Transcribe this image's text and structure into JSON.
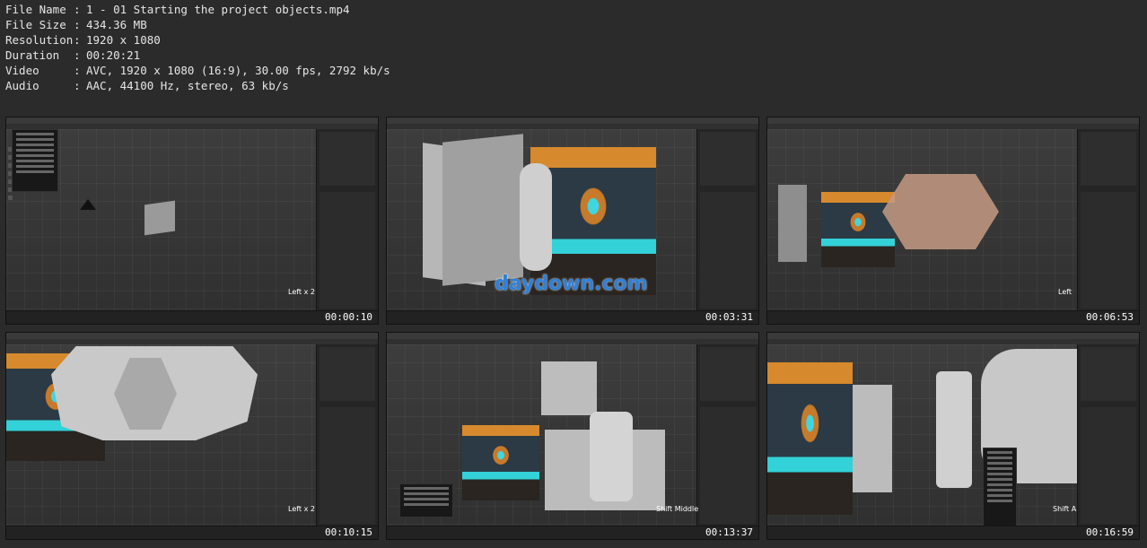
{
  "meta": {
    "rows": [
      {
        "key": "File Name",
        "value": "1 - 01 Starting the project objects.mp4"
      },
      {
        "key": "File Size",
        "value": "434.36 MB"
      },
      {
        "key": "Resolution",
        "value": "1920 x 1080"
      },
      {
        "key": "Duration",
        "value": "00:20:21"
      },
      {
        "key": "Video",
        "value": "AVC, 1920 x 1080 (16:9), 30.00 fps, 2792 kb/s"
      },
      {
        "key": "Audio",
        "value": "AAC, 44100 Hz, stereo, 63 kb/s"
      }
    ]
  },
  "thumbnails": [
    {
      "timestamp": "00:00:10",
      "hint": "Left x 2"
    },
    {
      "timestamp": "00:03:31",
      "hint": "",
      "watermark": "daydown.com"
    },
    {
      "timestamp": "00:06:53",
      "hint": "Left"
    },
    {
      "timestamp": "00:10:15",
      "hint": "Left x 2"
    },
    {
      "timestamp": "00:13:37",
      "hint": "Shift Middle"
    },
    {
      "timestamp": "00:16:59",
      "hint": "Shift A"
    }
  ],
  "colors": {
    "background": "#2b2b2b",
    "viewport": "#353535",
    "accent_cyan": "#3fd6e0",
    "accent_orange": "#d6892d"
  }
}
